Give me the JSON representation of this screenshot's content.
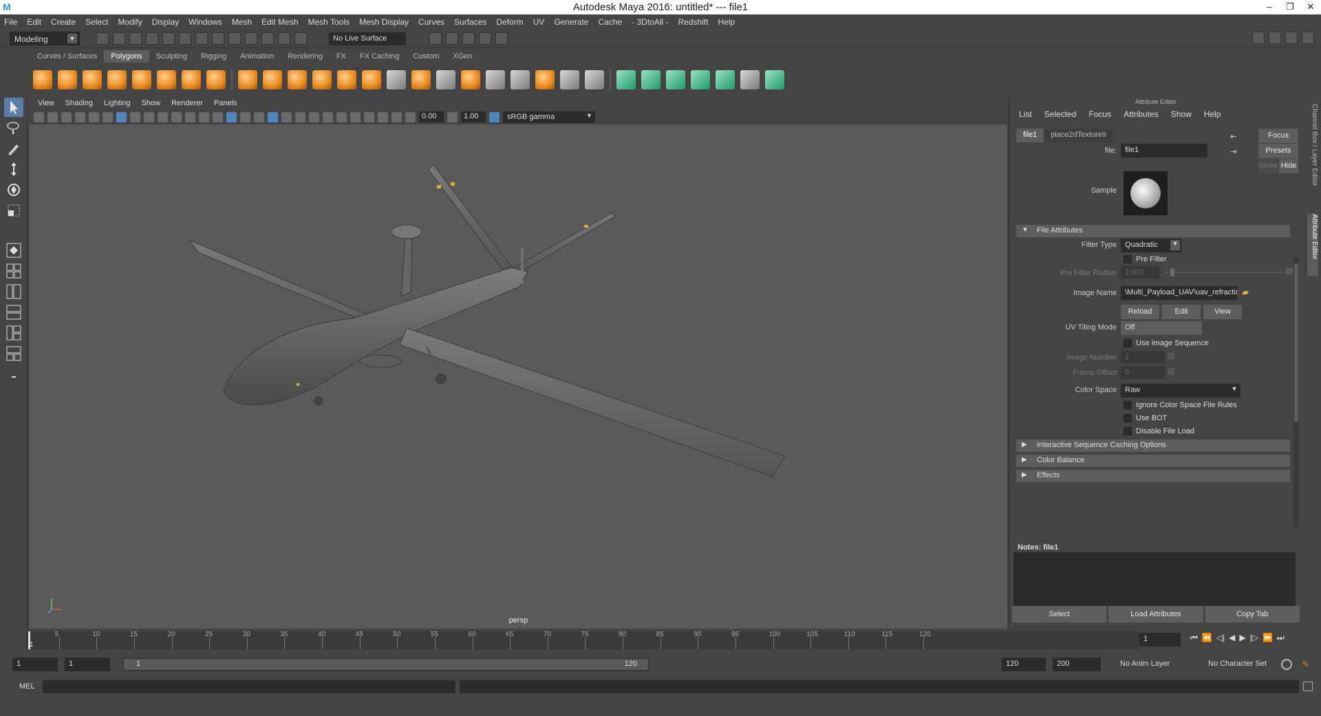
{
  "window": {
    "title": "Autodesk Maya 2016: untitled*   ---   file1"
  },
  "menubar": [
    "File",
    "Edit",
    "Create",
    "Select",
    "Modify",
    "Display",
    "Windows",
    "Mesh",
    "Edit Mesh",
    "Mesh Tools",
    "Mesh Display",
    "Curves",
    "Surfaces",
    "Deform",
    "UV",
    "Generate",
    "Cache",
    "- 3DtoAll -",
    "Redshift",
    "Help"
  ],
  "statusline": {
    "mode": "Modeling",
    "live_surface": "No Live Surface"
  },
  "shelf": {
    "tabs": [
      "Curves / Surfaces",
      "Polygons",
      "Sculpting",
      "Rigging",
      "Animation",
      "Rendering",
      "FX",
      "FX Caching",
      "Custom",
      "XGen"
    ],
    "active_tab": "Polygons"
  },
  "viewport": {
    "menu": [
      "View",
      "Shading",
      "Lighting",
      "Show",
      "Renderer",
      "Panels"
    ],
    "exposure": "0.00",
    "gamma": "1.00",
    "color_space": "sRGB gamma",
    "camera_label": "persp"
  },
  "attribute_editor": {
    "header": "Attribute Editor",
    "menu": [
      "List",
      "Selected",
      "Focus",
      "Attributes",
      "Show",
      "Help"
    ],
    "tabs": [
      "file1",
      "place2dTexture9"
    ],
    "file_label": "file:",
    "file_value": "file1",
    "buttons": {
      "focus": "Focus",
      "presets": "Presets",
      "show": "Show",
      "hide": "Hide"
    },
    "sample_label": "Sample",
    "sections": {
      "file_attributes": "File Attributes",
      "interactive": "Interactive Sequence Caching Options",
      "color_balance": "Color Balance",
      "effects": "Effects"
    },
    "filter_type": {
      "label": "Filter Type",
      "value": "Quadratic"
    },
    "pre_filter": "Pre Filter",
    "pre_filter_radius": {
      "label": "Pre Filter Radius",
      "value": "2.000"
    },
    "image_name": {
      "label": "Image Name",
      "value": "\\Multi_Payload_UAV\\uav_refraction.png"
    },
    "image_buttons": [
      "Reload",
      "Edit",
      "View"
    ],
    "uv_tiling": {
      "label": "UV Tiling Mode",
      "value": "Off"
    },
    "use_image_sequence": "Use Image Sequence",
    "image_number": {
      "label": "Image Number",
      "value": "1"
    },
    "frame_offset": {
      "label": "Frame Offset",
      "value": "0"
    },
    "color_space": {
      "label": "Color Space",
      "value": "Raw"
    },
    "checks": [
      "Ignore Color Space File Rules",
      "Use BOT",
      "Disable File Load"
    ],
    "notes_label": "Notes:  file1",
    "bottom_buttons": [
      "Select",
      "Load Attributes",
      "Copy Tab"
    ]
  },
  "side_tabs": [
    "Channel Box / Layer Editor",
    "Attribute Editor"
  ],
  "timeline": {
    "ticks": [
      "5",
      "10",
      "15",
      "20",
      "25",
      "30",
      "35",
      "40",
      "45",
      "50",
      "55",
      "60",
      "65",
      "70",
      "75",
      "80",
      "85",
      "90",
      "95",
      "100",
      "105",
      "110",
      "115",
      "120"
    ],
    "current": "1",
    "current_frame_field": "1"
  },
  "range": {
    "start": "1",
    "playback_start": "1",
    "slider_start": "1",
    "slider_end": "120",
    "playback_end": "120",
    "end": "200",
    "anim_layer": "No Anim Layer",
    "character_set": "No Character Set"
  },
  "command_line": {
    "label": "MEL"
  }
}
